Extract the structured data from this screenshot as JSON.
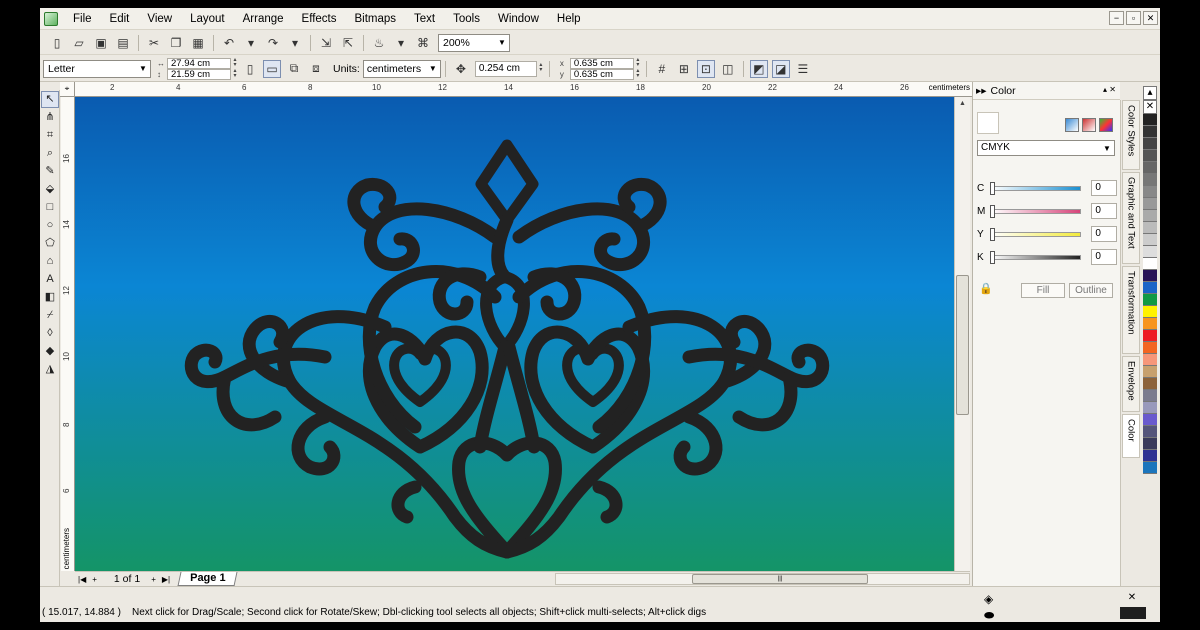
{
  "menu": [
    "File",
    "Edit",
    "View",
    "Layout",
    "Arrange",
    "Effects",
    "Bitmaps",
    "Text",
    "Tools",
    "Window",
    "Help"
  ],
  "window_controls": [
    "−",
    "▫",
    "✕"
  ],
  "toolbar": {
    "zoom": "200%"
  },
  "propbar": {
    "paper": "Letter",
    "width": "27.94 cm",
    "height": "21.59 cm",
    "units_label": "Units:",
    "units": "centimeters",
    "nudge": "0.254 cm",
    "dup_x": "0.635 cm",
    "dup_y": "0.635 cm"
  },
  "ruler": {
    "top_numbers": [
      "2",
      "4",
      "6",
      "8",
      "10",
      "12",
      "14",
      "16",
      "18",
      "20",
      "22",
      "24",
      "26"
    ],
    "top_units": "centimeters",
    "left_numbers": [
      "16",
      "14",
      "12",
      "10",
      "8",
      "6"
    ],
    "left_units": "centimeters"
  },
  "page_nav": {
    "count": "1 of 1",
    "tab": "Page 1"
  },
  "status": {
    "coords": "( 15.017, 14.884 )",
    "hint": "Next click for Drag/Scale; Second click for Rotate/Skew; Dbl-clicking tool selects all objects; Shift+click multi-selects; Alt+click digs"
  },
  "docker": {
    "title": "Color",
    "model": "CMYK",
    "sliders": [
      {
        "label": "C",
        "value": "0",
        "color": "#1b8fd0"
      },
      {
        "label": "M",
        "value": "0",
        "color": "#d6447a"
      },
      {
        "label": "Y",
        "value": "0",
        "color": "#f2ea3c"
      },
      {
        "label": "K",
        "value": "0",
        "color": "#222222"
      }
    ],
    "fill_label": "Fill",
    "outline_label": "Outline",
    "tabs": [
      "Color Styles",
      "Graphic and Text",
      "Transformation",
      "Envelope",
      "Color"
    ]
  },
  "palette": [
    "#222222",
    "#333333",
    "#444444",
    "#555555",
    "#666666",
    "#777777",
    "#888888",
    "#999999",
    "#aaaaaa",
    "#bbbbbb",
    "#cccccc",
    "#dddddd",
    "#ffffff",
    "#2a1458",
    "#1a64c8",
    "#119944",
    "#fff200",
    "#f7941d",
    "#ed1c24",
    "#f26522",
    "#f69679",
    "#c7a06d",
    "#8c6239",
    "#7b7b8e",
    "#9999bb",
    "#6a5acd",
    "#55557a",
    "#3a3a5a",
    "#2e3192",
    "#1c75bc"
  ],
  "canvas": {
    "gradient_top": "#0a5bb0",
    "gradient_mid": "#0b86d4",
    "gradient_bottom": "#149467",
    "ornament_color": "#222222"
  }
}
